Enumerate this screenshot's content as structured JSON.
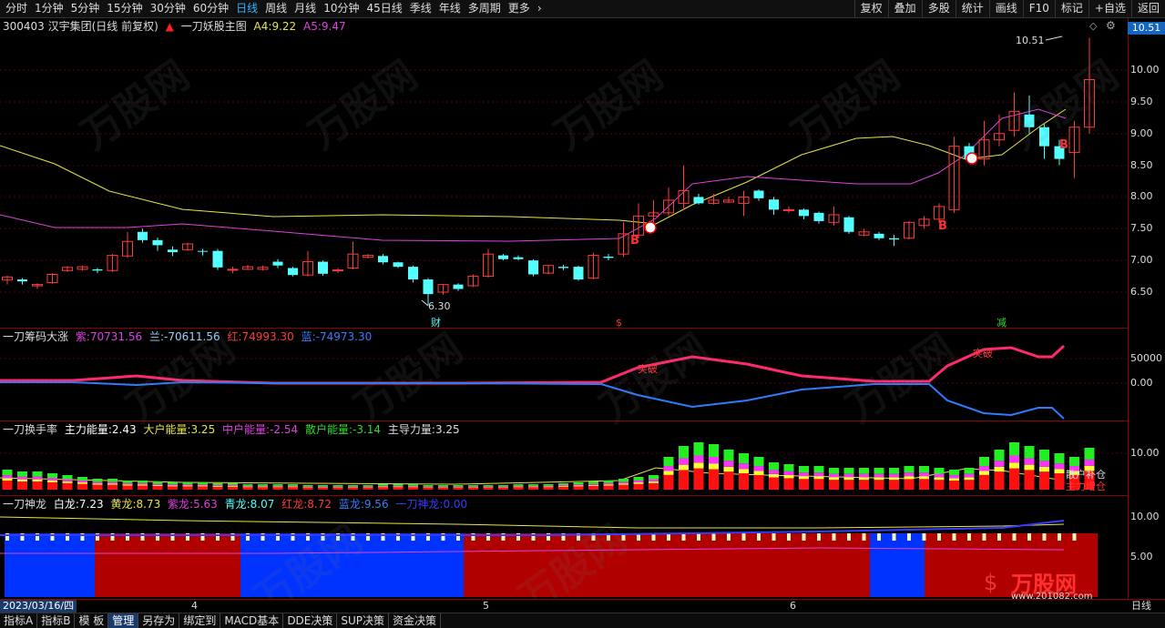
{
  "toolbar": {
    "periods": [
      "分时",
      "1分钟",
      "5分钟",
      "15分钟",
      "30分钟",
      "60分钟",
      "日线",
      "周线",
      "月线",
      "10分钟",
      "45日线",
      "季线",
      "年线",
      "多周期",
      "更多"
    ],
    "active_period": "日线",
    "more_chevron": "›",
    "tools": [
      "复权",
      "叠加",
      "多股",
      "统计",
      "画线",
      "F10",
      "标记",
      "+自选",
      "返回"
    ]
  },
  "main": {
    "stock": "300403 汉宇集团(日线 前复权)",
    "indicator": "一刀妖股主图",
    "a4_label": "A4:",
    "a4_value": "9.22",
    "a5_label": "A5:",
    "a5_value": "9.47",
    "price_axis": [
      "10.00",
      "9.50",
      "9.00",
      "8.50",
      "8.00",
      "7.50",
      "7.00",
      "6.50"
    ],
    "current_price": "10.51",
    "high_label": "10.51",
    "low_label": "6.30",
    "markers": [
      "B",
      "B",
      "B",
      "B"
    ],
    "bottom_tags": [
      "财",
      "$",
      "减"
    ]
  },
  "panel2": {
    "title": "一刀筹码大涨",
    "purple_label": "紫:",
    "purple_value": "70731.56",
    "orchid_label": "兰:",
    "orchid_value": "-70611.56",
    "red_label": "红:",
    "red_value": "74993.30",
    "blue_label": "蓝:",
    "blue_value": "-74973.30",
    "axis": [
      "50000",
      "0.00"
    ],
    "annotations": [
      "突破",
      "突破"
    ]
  },
  "panel3": {
    "title": "一刀换手率",
    "main_label": "主力能量:",
    "main_value": "2.43",
    "big_label": "大户能量:",
    "big_value": "3.25",
    "mid_label": "中户能量:",
    "mid_value": "-2.54",
    "retail_label": "散户能量:",
    "retail_value": "-3.14",
    "lead_label": "主导力量:",
    "lead_value": "3.25",
    "axis": [
      "10.00"
    ],
    "overlay_text1": "散户补仓",
    "overlay_text2": "主力增仓"
  },
  "panel4": {
    "title": "一刀神龙",
    "white_label": "白龙:",
    "white_value": "7.23",
    "yellow_label": "黄龙:",
    "yellow_value": "8.73",
    "purple_label": "紫龙:",
    "purple_value": "5.63",
    "cyan_label": "青龙:",
    "cyan_value": "8.07",
    "red_label": "红龙:",
    "red_value": "8.72",
    "blue_label": "蓝龙:",
    "blue_value": "9.56",
    "god_label": "一刀神龙:",
    "god_value": "0.00",
    "axis": [
      "10.00",
      "5.00"
    ]
  },
  "dates": {
    "current": "2023/03/16/四",
    "months": [
      "4",
      "5",
      "6"
    ],
    "period": "日线"
  },
  "bottom_tabs": [
    "指标A",
    "指标B",
    "模 板",
    "管理",
    "另存为",
    "绑定到",
    "MACD基本",
    "DDE决策",
    "SUP决策",
    "资金决策"
  ],
  "bottom_active": "管理",
  "watermark_text": "万股网",
  "logo_text": "万股网",
  "logo_url": "www.201082.com",
  "colors": {
    "up": "#ff3b3b",
    "down": "#53ffff",
    "yellow": "#e5e549",
    "magenta": "#e040e0",
    "red_fill": "#b00000",
    "blue_fill": "#0033ff"
  }
}
